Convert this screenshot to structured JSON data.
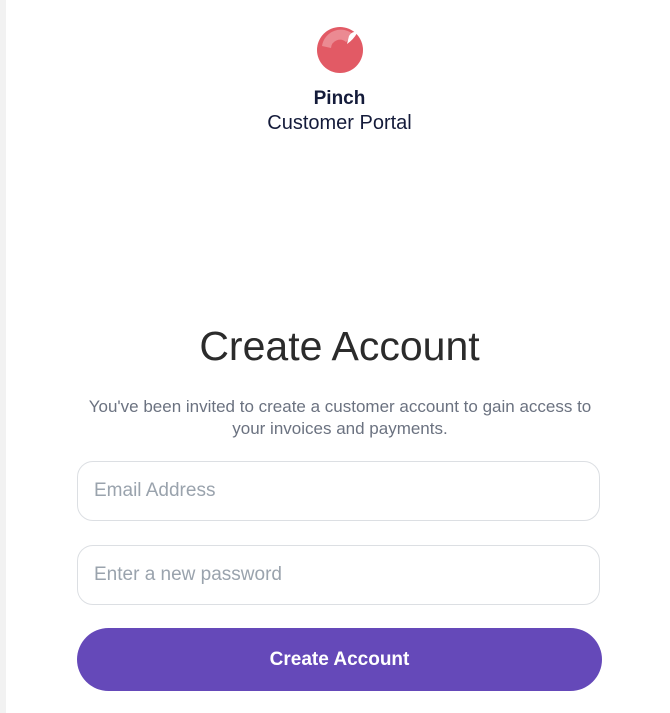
{
  "brand": {
    "logo_icon": "pinch-logo-icon",
    "name": "Pinch",
    "subtitle": "Customer Portal",
    "logo_color": "#e25a65"
  },
  "form": {
    "title": "Create Account",
    "description": "You've been invited to create a customer account to gain access to your invoices and payments.",
    "email_placeholder": "Email Address",
    "email_value": "",
    "password_placeholder": "Enter a new password",
    "password_value": "",
    "submit_label": "Create Account",
    "submit_color": "#6549b9"
  }
}
